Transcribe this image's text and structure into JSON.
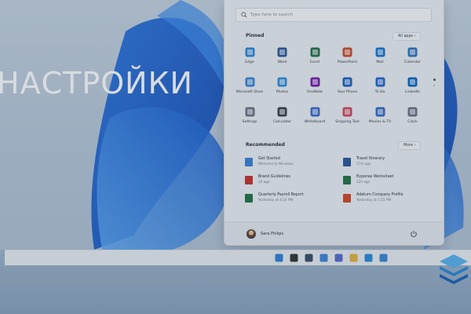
{
  "overlay": {
    "title": "НАСТРОЙКИ"
  },
  "start_menu": {
    "search_placeholder": "Type here to search",
    "pinned": {
      "heading": "Pinned",
      "all_apps_label": "All apps",
      "apps": [
        {
          "label": "Edge",
          "icon": "edge-icon",
          "color": "#2a88d8"
        },
        {
          "label": "Word",
          "icon": "word-icon",
          "color": "#2b579a"
        },
        {
          "label": "Excel",
          "icon": "excel-icon",
          "color": "#217346"
        },
        {
          "label": "PowerPoint",
          "icon": "powerpoint-icon",
          "color": "#d24726"
        },
        {
          "label": "Mail",
          "icon": "mail-icon",
          "color": "#1976d2"
        },
        {
          "label": "Calendar",
          "icon": "calendar-icon",
          "color": "#2f74c0"
        },
        {
          "label": "Microsoft Store",
          "icon": "store-icon",
          "color": "#3a86d6"
        },
        {
          "label": "Photos",
          "icon": "photos-icon",
          "color": "#2f8fdc"
        },
        {
          "label": "OneNote",
          "icon": "onenote-icon",
          "color": "#7719aa"
        },
        {
          "label": "Your Phone",
          "icon": "phone-icon",
          "color": "#1d5fc4"
        },
        {
          "label": "To Do",
          "icon": "todo-icon",
          "color": "#2564cf"
        },
        {
          "label": "LinkedIn",
          "icon": "linkedin-icon",
          "color": "#0a66c2"
        },
        {
          "label": "Settings",
          "icon": "gear-icon",
          "color": "#6b7280"
        },
        {
          "label": "Calculator",
          "icon": "calculator-icon",
          "color": "#3b3f46"
        },
        {
          "label": "Whiteboard",
          "icon": "whiteboard-icon",
          "color": "#3a6ccf"
        },
        {
          "label": "Snipping Tool",
          "icon": "snipping-tool-icon",
          "color": "#d3455b"
        },
        {
          "label": "Movies & TV",
          "icon": "movies-tv-icon",
          "color": "#3468c7"
        },
        {
          "label": "Clock",
          "icon": "clock-icon",
          "color": "#6b7280"
        }
      ]
    },
    "recommended": {
      "heading": "Recommended",
      "more_label": "More",
      "items": [
        {
          "title": "Get Started",
          "subtitle": "Welcome to Windows",
          "icon": "get-started-icon",
          "color": "#3b82d6"
        },
        {
          "title": "Travel Itinerary",
          "subtitle": "17m ago",
          "icon": "word-doc-icon",
          "color": "#2b579a"
        },
        {
          "title": "Brand Guidelines",
          "subtitle": "2h ago",
          "icon": "pdf-icon",
          "color": "#c9302c"
        },
        {
          "title": "Expense Worksheet",
          "subtitle": "12h ago",
          "icon": "excel-doc-icon",
          "color": "#217346"
        },
        {
          "title": "Quarterly Payroll Report",
          "subtitle": "Yesterday at 4:24 PM",
          "icon": "excel-doc-icon",
          "color": "#217346"
        },
        {
          "title": "Adatum Company Profile",
          "subtitle": "Yesterday at 1:15 PM",
          "icon": "powerpoint-doc-icon",
          "color": "#d24726"
        }
      ]
    },
    "user": {
      "name": "Sara Philips"
    }
  },
  "taskbar": {
    "icons": [
      "windows-icon",
      "search-icon",
      "task-view-icon",
      "widgets-icon",
      "chat-icon",
      "file-explorer-icon",
      "edge-icon",
      "store-icon"
    ]
  }
}
